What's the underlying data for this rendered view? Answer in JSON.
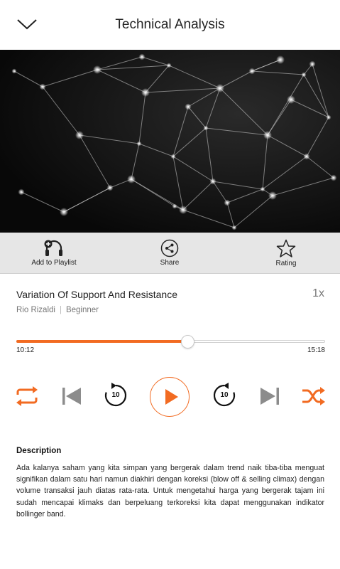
{
  "header": {
    "title": "Technical Analysis",
    "back_icon": "chevron-down-icon"
  },
  "actions": [
    {
      "label": "Add to Playlist",
      "icon": "headphones-add-icon"
    },
    {
      "label": "Share",
      "icon": "share-icon"
    },
    {
      "label": "Rating",
      "icon": "star-icon"
    }
  ],
  "track": {
    "title": "Variation Of Support And Resistance",
    "speed": "1x",
    "author": "Rio Rizaldi",
    "level": "Beginner"
  },
  "player": {
    "elapsed": "10:12",
    "duration": "15:18",
    "progress_fraction": 0.555,
    "rewind_seconds": "10",
    "forward_seconds": "10"
  },
  "description": {
    "heading": "Description",
    "body": "Ada kalanya saham yang kita simpan yang bergerak dalam trend naik tiba-tiba menguat signifikan dalam satu hari namun diakhiri dengan koreksi (blow off & selling climax) dengan volume transaksi jauh diatas rata-rata. Untuk mengetahui harga yang bergerak tajam ini sudah mencapai klimaks dan berpeluang terkoreksi kita dapat menggunakan indikator bollinger band."
  },
  "colors": {
    "accent": "#f26b22",
    "icon_gray": "#8c8c8c",
    "action_bar": "#e6e6e6"
  }
}
